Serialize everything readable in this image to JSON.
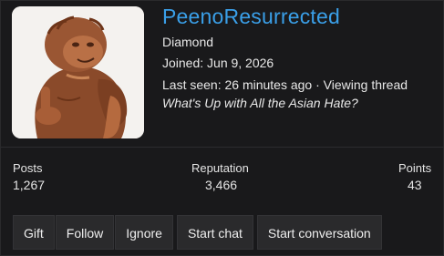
{
  "profile": {
    "username": "PeenoResurrected",
    "rank": "Diamond",
    "joined": "Joined: Jun 9, 2026",
    "last_seen": "Last seen: 26 minutes ago · Viewing thread",
    "thread_title": "What's Up with All the Asian Hate?"
  },
  "stats": [
    {
      "label": "Posts",
      "value": "1,267"
    },
    {
      "label": "Reputation",
      "value": "3,466"
    },
    {
      "label": "Points",
      "value": "43"
    }
  ],
  "actions": {
    "gift": "Gift",
    "follow": "Follow",
    "ignore": "Ignore",
    "start_chat": "Start chat",
    "start_conversation": "Start conversation"
  },
  "colors": {
    "background": "#19191b",
    "username": "#3a9fe8",
    "button_bg": "#2a2a2c"
  }
}
